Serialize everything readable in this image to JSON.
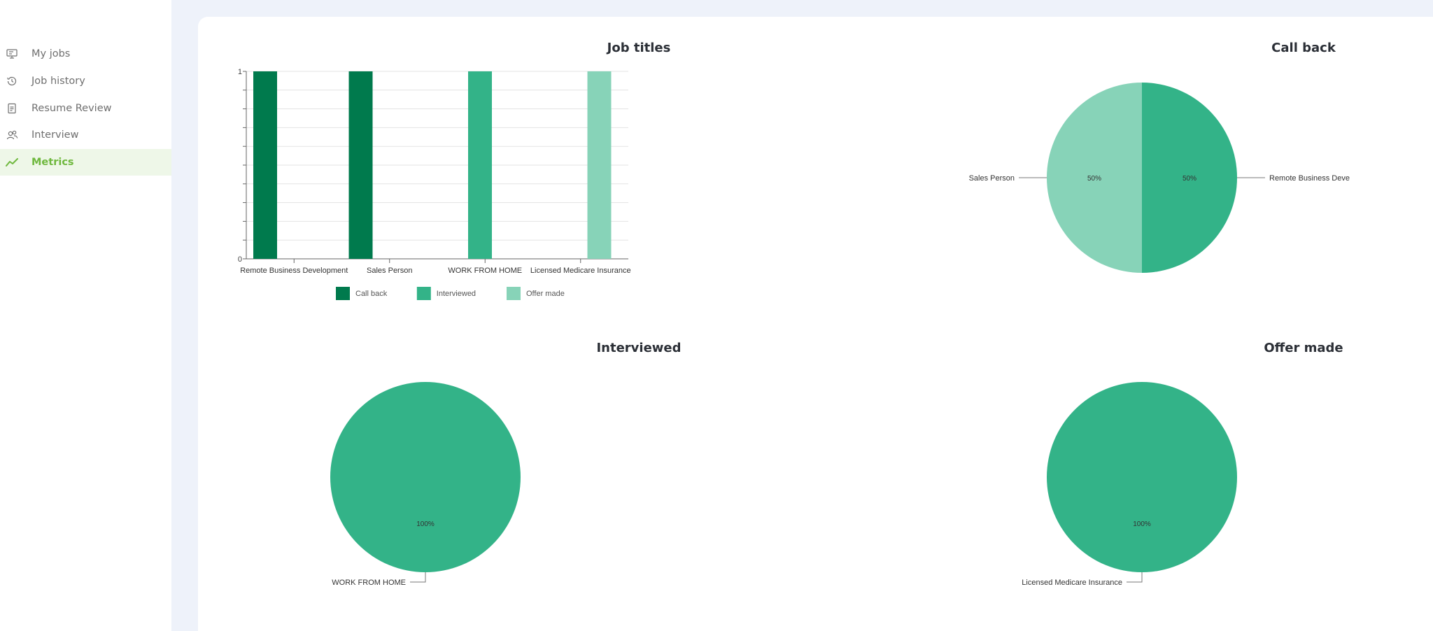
{
  "nav": {
    "items": [
      {
        "label": "My jobs",
        "icon": "monitor-icon",
        "active": false
      },
      {
        "label": "Job history",
        "icon": "history-icon",
        "active": false
      },
      {
        "label": "Resume Review",
        "icon": "document-icon",
        "active": false
      },
      {
        "label": "Interview",
        "icon": "people-icon",
        "active": false
      },
      {
        "label": "Metrics",
        "icon": "trend-line-icon",
        "active": true
      }
    ]
  },
  "colors": {
    "call_back": "#007a4d",
    "interviewed": "#33b388",
    "offer_made": "#87d3b8",
    "active_nav": "#6fb83e"
  },
  "panels": {
    "job_titles": {
      "title": "Job titles"
    },
    "call_back": {
      "title": "Call back"
    },
    "interviewed": {
      "title": "Interviewed"
    },
    "offer_made": {
      "title": "Offer made"
    }
  },
  "chart_data": [
    {
      "type": "bar",
      "title": "Job titles",
      "categories": [
        "Remote Business Development",
        "Sales Person",
        "WORK FROM HOME",
        "Licensed Medicare Insurance"
      ],
      "series": [
        {
          "name": "Call back",
          "values": [
            1,
            1,
            0,
            0
          ]
        },
        {
          "name": "Interviewed",
          "values": [
            0,
            0,
            1,
            0
          ]
        },
        {
          "name": "Offer made",
          "values": [
            0,
            0,
            0,
            1
          ]
        }
      ],
      "yticks": [
        "0",
        "1"
      ],
      "ylim": [
        0,
        1
      ],
      "grid": true,
      "legend": "bottom"
    },
    {
      "type": "pie",
      "title": "Call back",
      "slices": [
        {
          "label": "Remote Business Deve",
          "value": 50,
          "pct": "50%",
          "color": "#33b388"
        },
        {
          "label": "Sales Person",
          "value": 50,
          "pct": "50%",
          "color": "#87d3b8"
        }
      ]
    },
    {
      "type": "pie",
      "title": "Interviewed",
      "slices": [
        {
          "label": "WORK FROM HOME",
          "value": 100,
          "pct": "100%",
          "color": "#33b388"
        }
      ]
    },
    {
      "type": "pie",
      "title": "Offer made",
      "slices": [
        {
          "label": "Licensed Medicare Insurance",
          "value": 100,
          "pct": "100%",
          "color": "#33b388"
        }
      ]
    }
  ]
}
